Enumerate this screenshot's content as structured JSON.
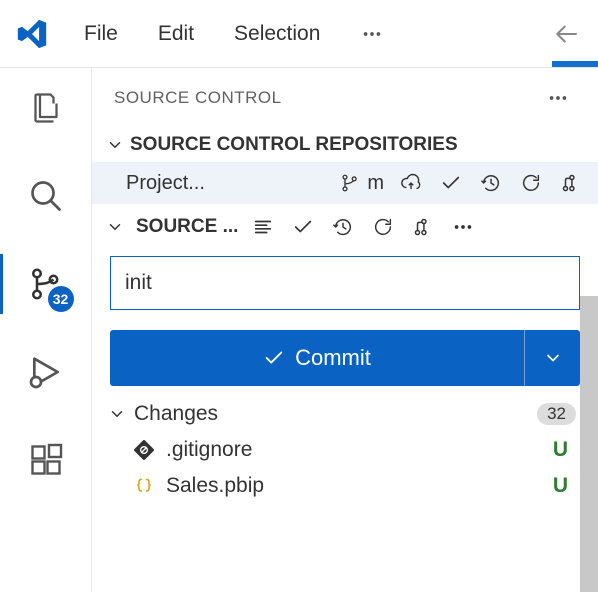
{
  "menubar": {
    "items": [
      "File",
      "Edit",
      "Selection"
    ]
  },
  "activitybar": {
    "scm_badge": "32"
  },
  "sidebar": {
    "title": "SOURCE CONTROL",
    "repos": {
      "title": "SOURCE CONTROL REPOSITORIES",
      "items": [
        {
          "name": "Project...",
          "branch": "m"
        }
      ]
    },
    "scm": {
      "title": "SOURCE ...",
      "commit_message": "init",
      "commit_button": "Commit",
      "changes_label": "Changes",
      "changes_count": "32",
      "files": [
        {
          "name": ".gitignore",
          "status": "U",
          "icon": "gitignore"
        },
        {
          "name": "Sales.pbip",
          "status": "U",
          "icon": "braces"
        }
      ]
    }
  }
}
